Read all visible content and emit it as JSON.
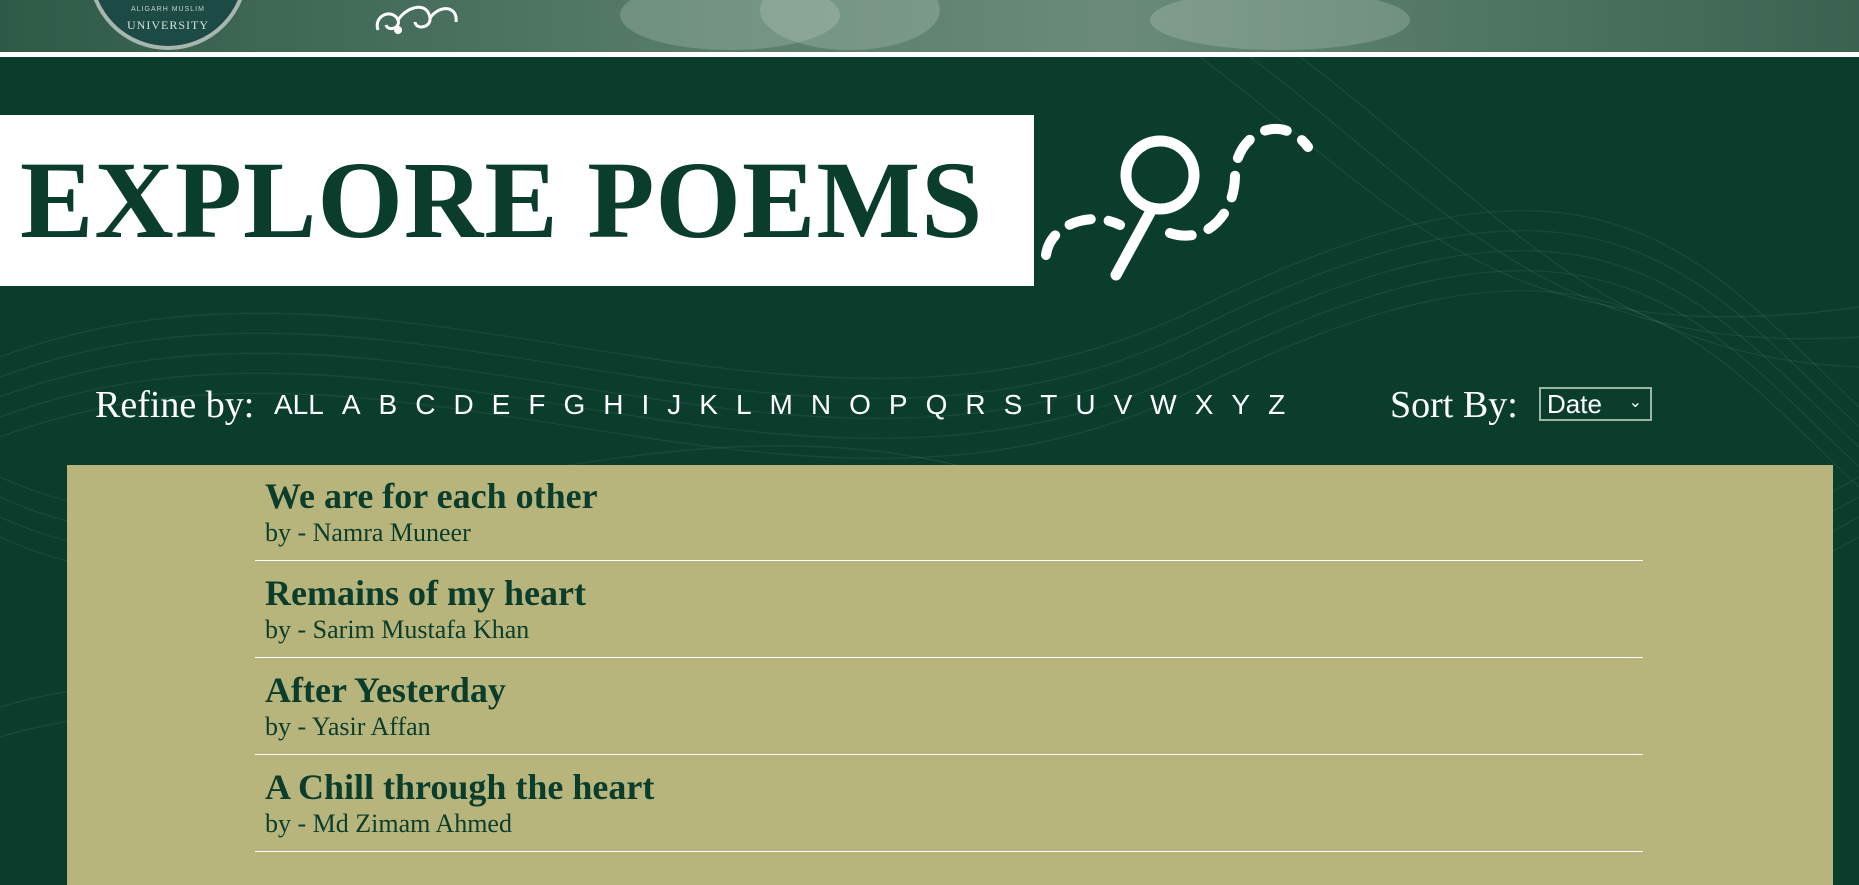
{
  "header": {
    "university_text": "UNIVERSITY",
    "university_small_text": "ALIGARH MUSLIM"
  },
  "page": {
    "title": "EXPLORE POEMS"
  },
  "filter": {
    "refine_label": "Refine by:",
    "letters": [
      "ALL",
      "A",
      "B",
      "C",
      "D",
      "E",
      "F",
      "G",
      "H",
      "I",
      "J",
      "K",
      "L",
      "M",
      "N",
      "O",
      "P",
      "Q",
      "R",
      "S",
      "T",
      "U",
      "V",
      "W",
      "X",
      "Y",
      "Z"
    ],
    "sort_label": "Sort By:",
    "sort_value": "Date"
  },
  "poems": [
    {
      "title": "We are for each other",
      "author": "by - Namra Muneer"
    },
    {
      "title": "Remains of my heart",
      "author": "by - Sarim Mustafa Khan"
    },
    {
      "title": "After Yesterday",
      "author": "by - Yasir Affan"
    },
    {
      "title": "A Chill through the heart",
      "author": "by - Md Zimam Ahmed"
    }
  ],
  "colors": {
    "brand_green": "#0b3d2c",
    "panel_khaki": "#b8b57c",
    "white": "#ffffff"
  },
  "icons": [
    "university-seal-icon",
    "swirl-logo-icon",
    "magnifier-icon",
    "chevron-down-icon"
  ]
}
